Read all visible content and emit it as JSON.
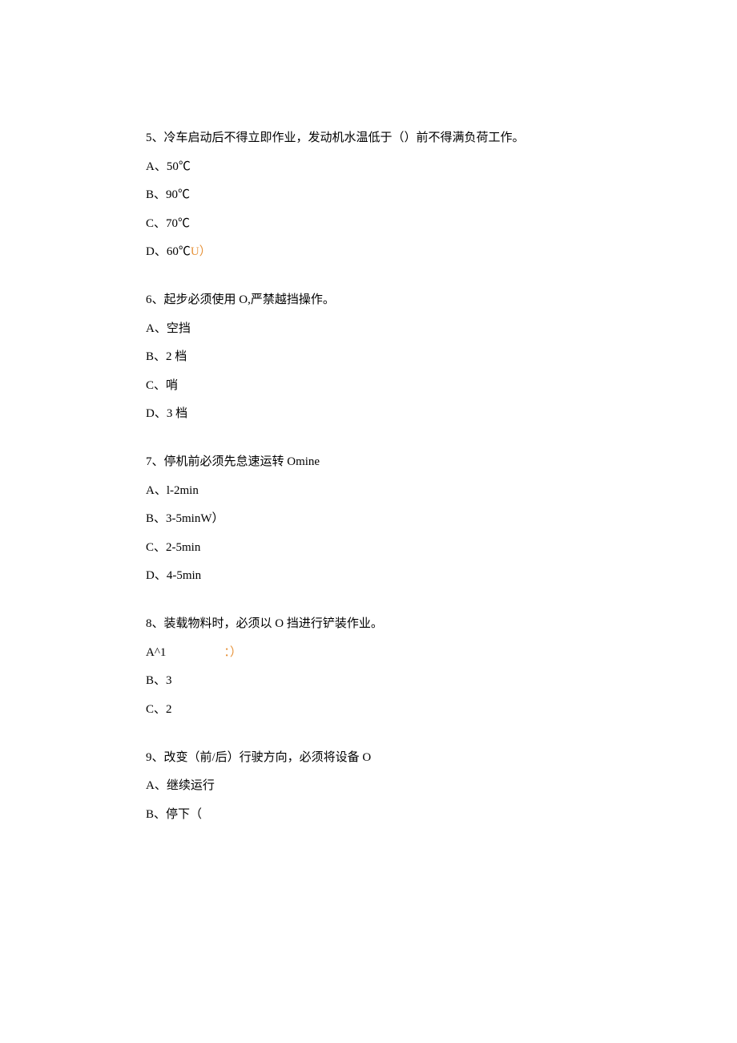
{
  "q5": {
    "stem": "5、冷车启动后不得立即作业，发动机水温低于（）前不得满负荷工作。",
    "a": "A、50℃",
    "b": "B、90℃",
    "c": "C、70℃",
    "d_prefix": "D、60℃",
    "d_suffix": "U）"
  },
  "q6": {
    "stem": "6、起步必须使用 O,严禁越挡操作。",
    "a": "A、空挡",
    "b": "B、2 档",
    "c": "C、哨",
    "d": "D、3 档"
  },
  "q7": {
    "stem": "7、停机前必须先怠速运转 Omine",
    "a": "A、l-2min",
    "b": "B、3-5minW）",
    "c": "C、2-5min",
    "d": "D、4-5min"
  },
  "q8": {
    "stem": "8、装载物料时，必须以 O 挡进行铲装作业。",
    "a_prefix": "A^1",
    "a_suffix": "：）",
    "b": "B、3",
    "c": "C、2"
  },
  "q9": {
    "stem": "9、改变（前/后）行驶方向，必须将设备 O",
    "a": "A、继续运行",
    "b": "B、停下（"
  }
}
